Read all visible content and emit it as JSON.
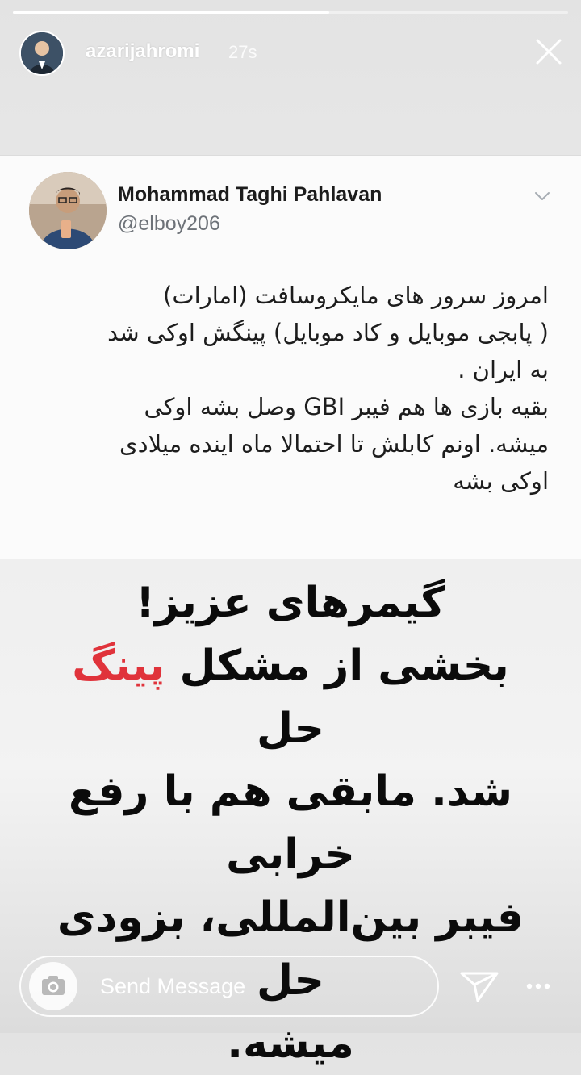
{
  "story": {
    "username": "azarijahromi",
    "time_ago": "27s",
    "progress": 0.57
  },
  "tweet": {
    "author_name": "Mohammad Taghi Pahlavan",
    "author_handle": "@elboy206",
    "lines": [
      "امروز سرور های مایکروسافت (امارات)",
      "( پابجی موبایل و کاد موبایل) پینگش اوکی شد",
      "به ایران .",
      "بقیه بازی ها هم فیبر GBI وصل بشه اوکی",
      "میشه. اونم کابلش تا احتمالا ماه اینده میلادی",
      "اوکی بشه"
    ]
  },
  "caption": {
    "line1": "گیمرهای عزیز!",
    "line2_before": "بخشی از مشکل ",
    "line2_highlight": "پینگ",
    "line2_after": " حل",
    "line3": "شد. مابقی هم با رفع خرابی",
    "line4": "فیبر بین‌المللی، بزودی حل",
    "line5": "میشه.",
    "highlight_color": "#e0333b"
  },
  "footer": {
    "message_placeholder": "Send Message"
  },
  "icons": {
    "close": "close-icon",
    "chevron": "chevron-down-icon",
    "camera": "camera-icon",
    "send": "send-icon",
    "more": "more-icon"
  }
}
